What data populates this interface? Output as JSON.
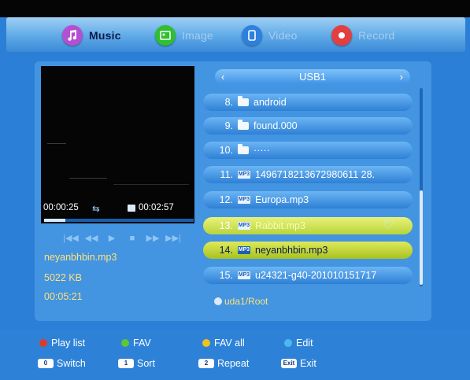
{
  "tabs": [
    {
      "label": "Music",
      "icon": "music-note-icon",
      "color": "#b44fd3",
      "active": true
    },
    {
      "label": "Image",
      "icon": "image-icon",
      "color": "#2fbf2f",
      "active": false
    },
    {
      "label": "Video",
      "icon": "video-icon",
      "color": "#2d7fe0",
      "active": false
    },
    {
      "label": "Record",
      "icon": "record-icon",
      "color": "#e24040",
      "active": false
    }
  ],
  "player": {
    "elapsed": "00:00:25",
    "duration": "00:02:57",
    "progress_fraction": 0.14,
    "controls": [
      "|◀◀",
      "◀◀",
      "▶",
      "■",
      "▶▶",
      "▶▶|"
    ]
  },
  "file_info": {
    "name": "neyanbhbin.mp3",
    "size": "5022 KB",
    "length": "00:05:21"
  },
  "browser": {
    "title": "USB1",
    "prev": "‹",
    "next": "›",
    "rows": [
      {
        "num": "8.",
        "type": "folder",
        "name": "android",
        "state": "normal"
      },
      {
        "num": "9.",
        "type": "folder",
        "name": "found.000",
        "state": "normal"
      },
      {
        "num": "10.",
        "type": "folder",
        "name": "·····",
        "state": "normal"
      },
      {
        "num": "11.",
        "type": "mp3",
        "name": "1496718213672980611 28.",
        "state": "normal"
      },
      {
        "num": "12.",
        "type": "mp3",
        "name": "Europa.mp3",
        "state": "normal"
      },
      {
        "num": "13.",
        "type": "mp3",
        "name": "Rabbit.mp3",
        "state": "hi",
        "fav": true
      },
      {
        "num": "14.",
        "type": "mp3",
        "name": "neyanbhbin.mp3",
        "state": "sel"
      },
      {
        "num": "15.",
        "type": "mp3",
        "name": "u24321-g40-201010151717",
        "state": "normal"
      }
    ],
    "path": "uda1/Root"
  },
  "legend": {
    "row1": [
      {
        "label": "Play list",
        "color": "#e03a2e"
      },
      {
        "label": "FAV",
        "color": "#5fc72f"
      },
      {
        "label": "FAV all",
        "color": "#f0c21b"
      },
      {
        "label": "Edit",
        "color": "#4fb8ee"
      }
    ],
    "row2": [
      {
        "key": "0",
        "label": "Switch"
      },
      {
        "key": "1",
        "label": "Sort"
      },
      {
        "key": "2",
        "label": "Repeat"
      },
      {
        "key": "Exit",
        "label": "Exit"
      }
    ]
  }
}
